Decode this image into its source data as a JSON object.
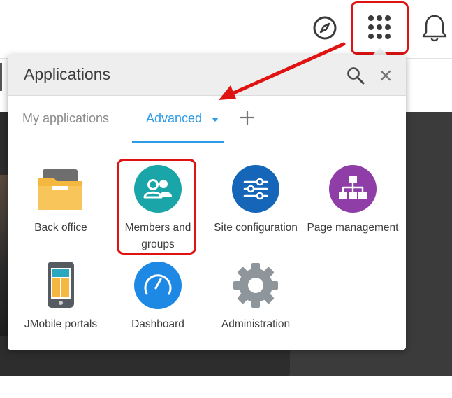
{
  "popup": {
    "title": "Applications",
    "tabs": [
      {
        "label": "My applications",
        "active": false
      },
      {
        "label": "Advanced",
        "active": true
      }
    ]
  },
  "apps": [
    {
      "label": "Back office",
      "icon": "folder-icon"
    },
    {
      "label": "Members and groups",
      "icon": "users-icon"
    },
    {
      "label": "Site configuration",
      "icon": "sliders-icon"
    },
    {
      "label": "Page management",
      "icon": "sitemap-icon"
    },
    {
      "label": "JMobile portals",
      "icon": "mobile-icon"
    },
    {
      "label": "Dashboard",
      "icon": "gauge-icon"
    },
    {
      "label": "Administration",
      "icon": "gear-icon"
    }
  ],
  "colors": {
    "accent": "#2e9be6",
    "highlight": "#e01313",
    "teal": "#1aa6a8",
    "navy": "#1565b8",
    "purple": "#8e3ea6",
    "blue": "#1e88e5",
    "folder": "#f4b740",
    "gray_gear": "#8e969c"
  }
}
